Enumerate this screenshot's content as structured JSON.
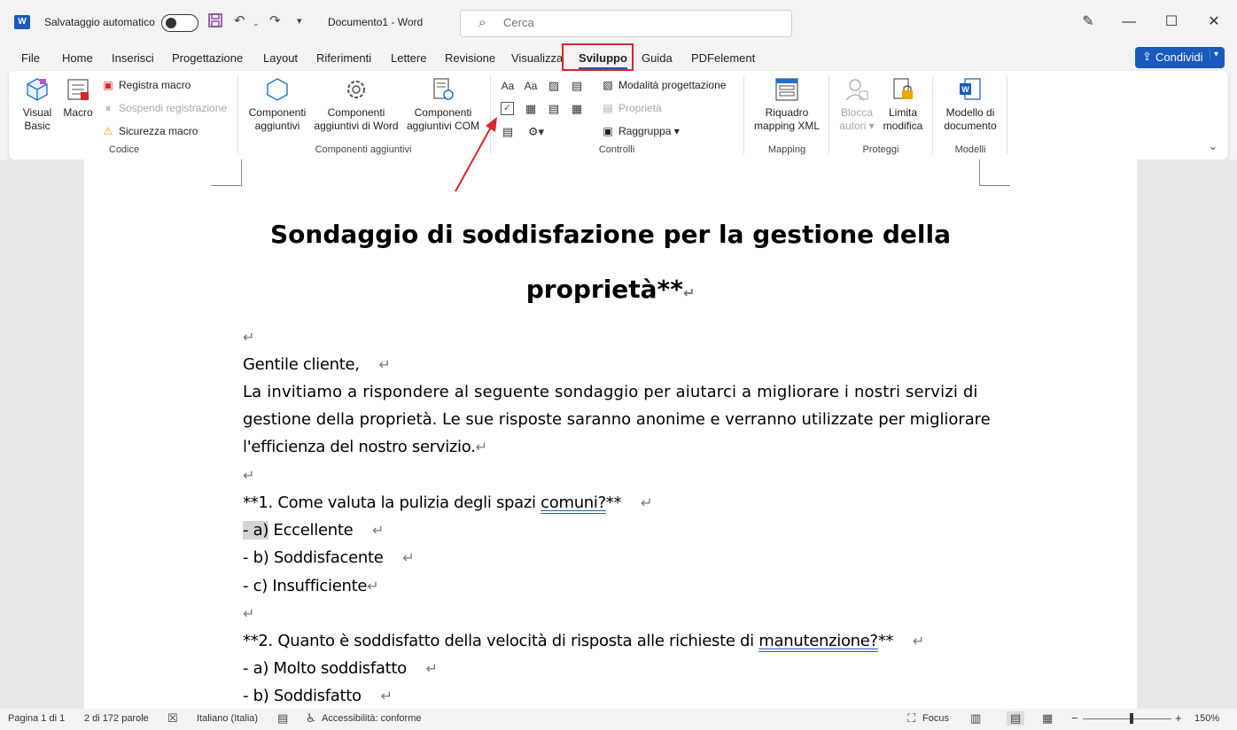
{
  "titlebar": {
    "app_icon": "W",
    "autosave_label": "Salvataggio automatico",
    "autosave_state": "off",
    "doc_title": "Documento1  -  Word",
    "search_placeholder": "Cerca",
    "icons": [
      "save-icon",
      "undo-icon",
      "redo-icon",
      "customize-icon",
      "designer-icon",
      "minimize-icon",
      "maximize-icon",
      "close-icon"
    ]
  },
  "tabs": [
    {
      "label": "File"
    },
    {
      "label": "Home"
    },
    {
      "label": "Inserisci"
    },
    {
      "label": "Progettazione"
    },
    {
      "label": "Layout"
    },
    {
      "label": "Riferimenti"
    },
    {
      "label": "Lettere"
    },
    {
      "label": "Revisione"
    },
    {
      "label": "Visualizza"
    },
    {
      "label": "Sviluppo",
      "active": true
    },
    {
      "label": "Guida"
    },
    {
      "label": "PDFelement"
    }
  ],
  "share_button": "Condividi",
  "ribbon": {
    "codice": {
      "label": "Codice",
      "visual_basic_1": "Visual",
      "visual_basic_2": "Basic",
      "macro": "Macro",
      "registra_macro": "Registra macro",
      "sospendi": "Sospendi registrazione",
      "sicurezza": "Sicurezza macro"
    },
    "componenti": {
      "label": "Componenti aggiuntivi",
      "comp_1a": "Componenti",
      "comp_1b": "aggiuntivi",
      "comp_2a": "Componenti",
      "comp_2b": "aggiuntivi di Word",
      "comp_3a": "Componenti",
      "comp_3b": "aggiuntivi COM"
    },
    "controlli": {
      "label": "Controlli",
      "modalita": "Modalità progettazione",
      "proprieta": "Proprietà",
      "raggruppa": "Raggruppa"
    },
    "mapping": {
      "label": "Mapping",
      "riquadro_1": "Riquadro",
      "riquadro_2": "mapping XML"
    },
    "proteggi": {
      "label": "Proteggi",
      "blocca_1": "Blocca",
      "blocca_2": "autori",
      "limita_1": "Limita",
      "limita_2": "modifica"
    },
    "modelli": {
      "label": "Modelli",
      "modello_1": "Modello di",
      "modello_2": "documento"
    }
  },
  "document": {
    "title_line1": "Sondaggio di soddisfazione per la gestione della",
    "title_line2": "proprietà**",
    "salutation": "Gentile cliente,",
    "intro_line1": "La invitiamo a rispondere al seguente sondaggio per aiutarci a migliorare i nostri servizi di",
    "intro_line2": "gestione della proprietà. Le sue risposte saranno anonime e verranno utilizzate per migliorare",
    "intro_line3": "l'efficienza del nostro servizio.",
    "q1_prefix": "**1. Come valuta la pulizia degli spazi ",
    "q1_word": "comuni?",
    "q1_suffix": "**",
    "q1_a_hl": "- a)",
    "q1_a_rest": " Eccellente",
    "q1_b": "- b) Soddisfacente",
    "q1_c": "- c) Insufficiente",
    "q2_prefix": "**2. Quanto è soddisfatto della velocità di risposta alle richieste di ",
    "q2_word": "manutenzione?",
    "q2_suffix": "**",
    "q2_a": "- a) Molto soddisfatto",
    "q2_b": "- b) Soddisfatto",
    "paragraph_mark": "↵"
  },
  "statusbar": {
    "page": "Pagina 1 di 1",
    "words": "2 di 172 parole",
    "language": "Italiano (Italia)",
    "accessibility": "Accessibilità: conforme",
    "focus": "Focus",
    "zoom": "150%",
    "zoom_minus": "−",
    "zoom_plus": "+"
  },
  "colors": {
    "accent": "#185abd",
    "highlight_box": "#d9262e",
    "arrow": "#d9262e"
  }
}
